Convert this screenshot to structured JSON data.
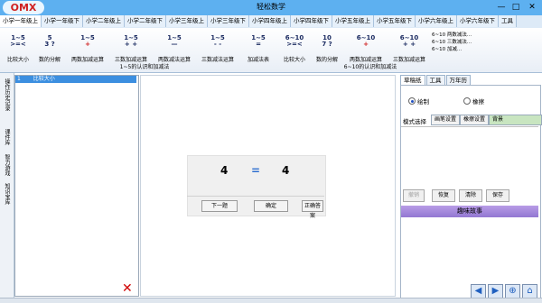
{
  "app": {
    "logo_text": "OMX",
    "title": "轻松数学"
  },
  "window_controls": {
    "minimize": "—",
    "maximize": "□",
    "close": "✕"
  },
  "tabs": [
    "小学一年级上",
    "小学一年级下",
    "小学二年级上",
    "小学二年级下",
    "小学三年级上",
    "小学三年级下",
    "小学四年级上",
    "小学四年级下",
    "小学五年级上",
    "小学五年级下",
    "小学六年级上",
    "小学六年级下",
    "工具"
  ],
  "ribbon": {
    "group1_label": "1~5的认识和加减法",
    "group2_label": "6~10的认识和加减法",
    "items": [
      {
        "icon_top": "1~5",
        "icon_mid": ">=<",
        "label": "比较大小"
      },
      {
        "icon_top": "5",
        "icon_mid": "3 ?",
        "label": "数的分解"
      },
      {
        "icon_top": "1~5",
        "icon_mid": "+",
        "label": "两数加减运算"
      },
      {
        "icon_top": "1~5",
        "icon_mid": "+ +",
        "label": "三数加减运算"
      },
      {
        "icon_top": "1~5",
        "icon_mid": "—",
        "label": "两数减法运算"
      },
      {
        "icon_top": "1~5",
        "icon_mid": "- -",
        "label": "三数减法运算"
      },
      {
        "icon_top": "1~5",
        "icon_mid": "=",
        "label": "加减法表"
      },
      {
        "icon_top": "6~10",
        "icon_mid": ">=<",
        "label": "比较大小"
      },
      {
        "icon_top": "10",
        "icon_mid": "7 ?",
        "label": "数的分解"
      },
      {
        "icon_top": "6~10",
        "icon_mid": "+",
        "label": "两数加减运算"
      },
      {
        "icon_top": "6~10",
        "icon_mid": "+ +",
        "label": "三数加减运算"
      }
    ],
    "small_items": [
      "6~10 两数减法...",
      "6~10 三数减法...",
      "6~10 加减..."
    ]
  },
  "left_tabs": [
    "操作历史记录",
    "课件库",
    "智力游戏",
    "知识宝库"
  ],
  "list": {
    "rows": [
      {
        "num": "1",
        "text": "比较大小"
      }
    ]
  },
  "quiz": {
    "left": "4",
    "op": "=",
    "right": "4",
    "buttons": [
      "下一题",
      "确定",
      "正确答案"
    ]
  },
  "right_panel": {
    "tabs": [
      "草稿纸",
      "工具",
      "万年历"
    ],
    "radio_draw": "绘制",
    "radio_erase": "橡擦",
    "mode_label": "模式选择",
    "mode_buttons": [
      "画笔设置",
      "橡擦设置",
      "背景"
    ],
    "action_buttons": [
      "撤销",
      "恢复",
      "清除",
      "保存"
    ],
    "story_label": "趣味故事"
  },
  "nav_icons": [
    "back-icon",
    "forward-icon",
    "zoom-icon",
    "home-icon"
  ]
}
